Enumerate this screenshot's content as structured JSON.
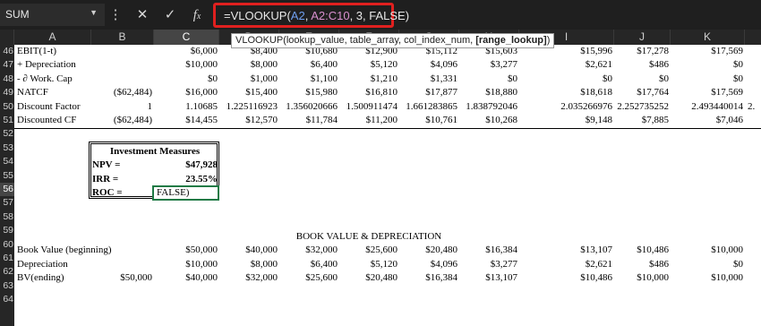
{
  "namebox": {
    "value": "SUM",
    "dropdown_icon": "chevron-down-icon"
  },
  "formula_bar": {
    "icons": {
      "more": "vertical-dots-icon",
      "cancel": "close-icon",
      "enter": "checkmark-icon",
      "function": "fx-icon"
    },
    "formula_prefix": "=VLOOKUP(",
    "arg_ref1": "A2",
    "sep1": ", ",
    "arg_ref2": "A2:C10",
    "formula_suffix": ", 3, FALSE)",
    "highlight_color": "#e0201f"
  },
  "tooltip": {
    "text_plain": "VLOOKUP(lookup_value, table_array, col_index_num, ",
    "text_bold": "[range_lookup]",
    "text_end": ")"
  },
  "columns": [
    "A",
    "B",
    "C",
    "D",
    "E",
    "F",
    "G",
    "H",
    "I",
    "J",
    "K"
  ],
  "rows": [
    "46",
    "47",
    "48",
    "49",
    "50",
    "51",
    "52",
    "53",
    "54",
    "55",
    "56",
    "57",
    "58",
    "59",
    "60",
    "61",
    "62",
    "63",
    "64"
  ],
  "cashflow": {
    "r46": {
      "label": "EBIT(1-t)",
      "vals": [
        "$6,000",
        "$8,400",
        "$10,680",
        "$12,900",
        "$15,112",
        "$15,603",
        "$15,996",
        "$17,278",
        "$17,569"
      ]
    },
    "r47": {
      "label": " + Depreciation",
      "vals": [
        "$10,000",
        "$8,000",
        "$6,400",
        "$5,120",
        "$4,096",
        "$3,277",
        "$2,621",
        "$486",
        "$0"
      ]
    },
    "r48": {
      "label": " - ∂ Work. Cap",
      "vals": [
        "$0",
        "$1,000",
        "$1,100",
        "$1,210",
        "$1,331",
        "$0",
        "$0",
        "$0",
        "$0"
      ]
    },
    "r49": {
      "label": "NATCF",
      "b": "($62,484)",
      "vals": [
        "$16,000",
        "$15,400",
        "$15,980",
        "$16,810",
        "$17,877",
        "$18,880",
        "$18,618",
        "$17,764",
        "$17,569"
      ]
    },
    "r50": {
      "label": "Discount Factor",
      "b": "1",
      "vals": [
        "1.10685",
        "1.225116923",
        "1.356020666",
        "1.500911474",
        "1.661283865",
        "1.838792046",
        "2.035266976",
        "2.252735252",
        "2.493440014"
      ],
      "overflow": "2."
    },
    "r51": {
      "label": "Discounted CF",
      "b": "($62,484)",
      "vals": [
        "$14,455",
        "$12,570",
        "$11,784",
        "$11,200",
        "$10,761",
        "$10,268",
        "$9,148",
        "$7,885",
        "$7,046"
      ],
      "overflow": ""
    }
  },
  "investment": {
    "title": "Investment Measures",
    "npv_label": "NPV =",
    "npv": "$47,928",
    "irr_label": "IRR =",
    "irr": "23.55%",
    "roc_label": "ROC =",
    "roc_edit": "FALSE)"
  },
  "book": {
    "title": "BOOK VALUE & DEPRECIATION",
    "r60": {
      "label": "Book Value (beginning)",
      "vals": [
        "$50,000",
        "$40,000",
        "$32,000",
        "$25,600",
        "$20,480",
        "$16,384",
        "$13,107",
        "$10,486",
        "$10,000"
      ]
    },
    "r61": {
      "label": "Depreciation",
      "vals": [
        "$10,000",
        "$8,000",
        "$6,400",
        "$5,120",
        "$4,096",
        "$3,277",
        "$2,621",
        "$486",
        "$0"
      ]
    },
    "r62": {
      "label": "BV(ending)",
      "b": "$50,000",
      "vals": [
        "$40,000",
        "$32,000",
        "$25,600",
        "$20,480",
        "$16,384",
        "$13,107",
        "$10,486",
        "$10,000",
        "$10,000"
      ]
    }
  }
}
